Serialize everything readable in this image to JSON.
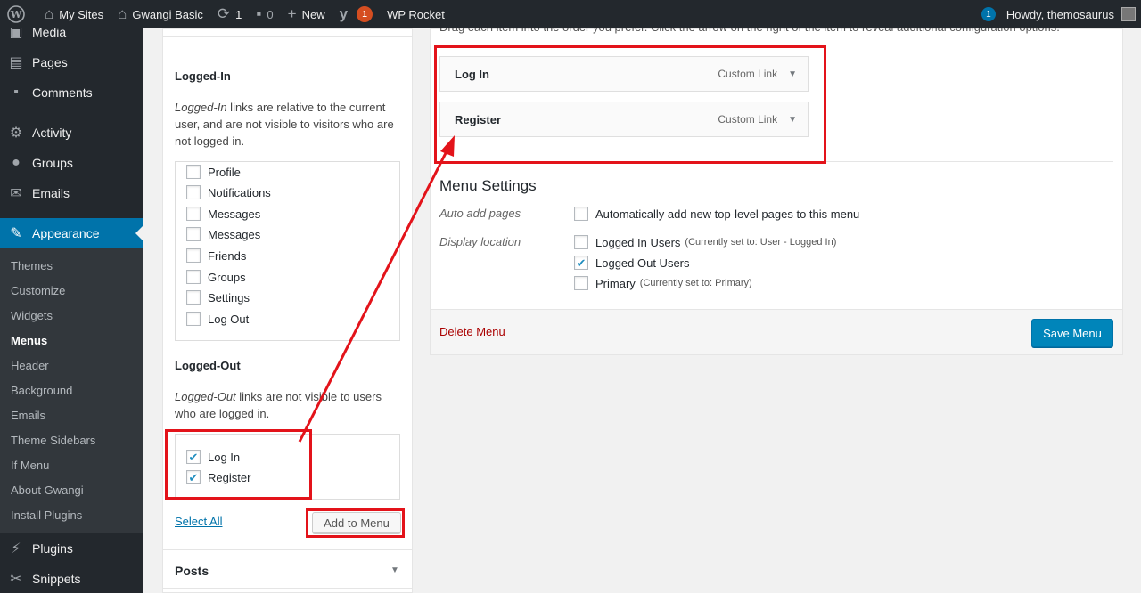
{
  "adminbar": {
    "my_sites": "My Sites",
    "site_name": "Gwangi Basic",
    "updates_count": "1",
    "comments_count": "0",
    "new_label": "New",
    "yoast_badge": "1",
    "wp_rocket": "WP Rocket",
    "notif_badge": "1",
    "howdy": "Howdy, themosaurus"
  },
  "sidebar": {
    "items_top": [
      {
        "label": "Media",
        "icon": "media-icon"
      },
      {
        "label": "Pages",
        "icon": "pages-icon"
      },
      {
        "label": "Comments",
        "icon": "comments-icon"
      },
      {
        "label": "Activity",
        "icon": "activity-icon"
      },
      {
        "label": "Groups",
        "icon": "groups-icon"
      },
      {
        "label": "Emails",
        "icon": "emails-icon"
      }
    ],
    "current": {
      "label": "Appearance",
      "icon": "appearance-icon"
    },
    "submenu": [
      "Themes",
      "Customize",
      "Widgets",
      "Menus",
      "Header",
      "Background",
      "Emails",
      "Theme Sidebars",
      "If Menu",
      "About Gwangi",
      "Install Plugins"
    ],
    "active_submenu": "Menus",
    "items_bottom": [
      {
        "label": "Plugins",
        "icon": "plugins-icon"
      },
      {
        "label": "Snippets",
        "icon": "snippets-icon"
      }
    ]
  },
  "left_panel": {
    "logged_in": {
      "heading": "Logged-In",
      "desc_em": "Logged-In",
      "desc_rest": " links are relative to the current user, and are not visible to visitors who are not logged in.",
      "items": [
        "Profile",
        "Notifications",
        "Messages",
        "Messages",
        "Friends",
        "Groups",
        "Settings",
        "Log Out"
      ]
    },
    "logged_out": {
      "heading": "Logged-Out",
      "desc_em": "Logged-Out",
      "desc_rest": " links are not visible to users who are logged in.",
      "items": [
        "Log In",
        "Register"
      ],
      "checked": [
        true,
        true
      ]
    },
    "select_all": "Select All",
    "add_to_menu": "Add to Menu",
    "posts_title": "Posts"
  },
  "right_panel": {
    "cutoff_text": "Drag each item into the order you prefer. Click the arrow on the right of the item to reveal additional configuration options.",
    "menu_items": [
      {
        "title": "Log In",
        "type": "Custom Link"
      },
      {
        "title": "Register",
        "type": "Custom Link"
      }
    ],
    "menu_settings_title": "Menu Settings",
    "auto_add_label": "Auto add pages",
    "auto_add_option": "Automatically add new top-level pages to this menu",
    "display_location_label": "Display location",
    "locations": [
      {
        "label": "Logged In Users",
        "note": "(Currently set to: User - Logged In)",
        "checked": false
      },
      {
        "label": "Logged Out Users",
        "note": "",
        "checked": true
      },
      {
        "label": "Primary",
        "note": "(Currently set to: Primary)",
        "checked": false
      }
    ],
    "delete_menu": "Delete Menu",
    "save_menu": "Save Menu"
  },
  "colors": {
    "adminbar_bg": "#23282d",
    "accent_blue": "#0073aa",
    "annotation_red": "#e3131a",
    "delete_red": "#aa0000"
  }
}
